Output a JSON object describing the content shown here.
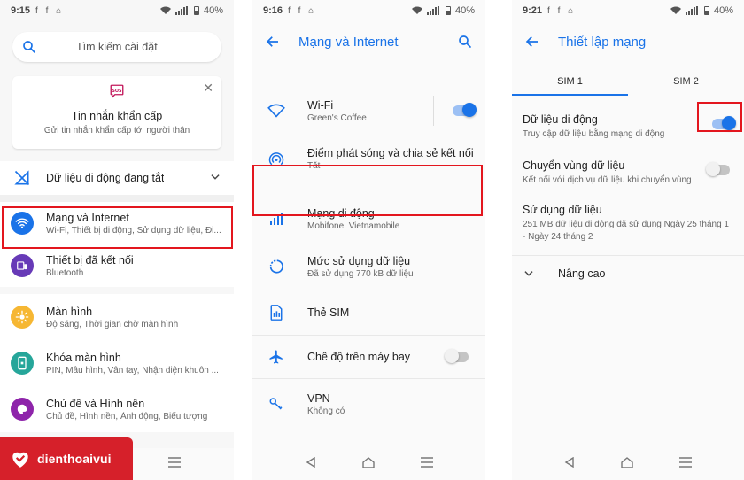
{
  "phone1": {
    "status": {
      "time": "9:15",
      "battery": "40%"
    },
    "search": {
      "placeholder": "Tìm kiếm cài đặt"
    },
    "card": {
      "title": "Tin nhắn khẩn cấp",
      "subtitle": "Gửi tin nhắn khẩn cấp tới người thân"
    },
    "items": [
      {
        "title": "Dữ liệu di động đang tắt"
      },
      {
        "title": "Mạng và Internet",
        "subtitle": "Wi-Fi, Thiết bị di động, Sử dụng dữ liệu, Đi..."
      },
      {
        "title": "Thiết bị đã kết nối",
        "subtitle": "Bluetooth"
      },
      {
        "title": "Màn hình",
        "subtitle": "Độ sáng, Thời gian chờ màn hình"
      },
      {
        "title": "Khóa màn hình",
        "subtitle": "PIN, Mẫu hình, Vân tay, Nhận diện khuôn ..."
      },
      {
        "title": "Chủ đề và Hình nền",
        "subtitle": "Chủ đề, Hình nền, Ảnh động, Biểu tượng"
      }
    ]
  },
  "phone2": {
    "status": {
      "time": "9:16",
      "battery": "40%"
    },
    "title": "Mạng và Internet",
    "items": [
      {
        "title": "Wi-Fi",
        "subtitle": "Green's Coffee"
      },
      {
        "title": "Điểm phát sóng và chia sẻ kết nối",
        "subtitle": "Tắt"
      },
      {
        "title": "Mạng di động",
        "subtitle": "Mobifone, Vietnamobile"
      },
      {
        "title": "Mức sử dụng dữ liệu",
        "subtitle": "Đã sử dụng 770 kB dữ liệu"
      },
      {
        "title": "Thẻ SIM"
      },
      {
        "title": "Chế độ trên máy bay"
      },
      {
        "title": "VPN",
        "subtitle": "Không có"
      }
    ]
  },
  "phone3": {
    "status": {
      "time": "9:21",
      "battery": "40%"
    },
    "title": "Thiết lập mạng",
    "tabs": [
      "SIM 1",
      "SIM 2"
    ],
    "items": [
      {
        "title": "Dữ liệu di động",
        "subtitle": "Truy cập dữ liệu bằng mạng di động"
      },
      {
        "title": "Chuyển vùng dữ liệu",
        "subtitle": "Kết nối với dịch vụ dữ liệu khi chuyển vùng"
      },
      {
        "title": "Sử dụng dữ liệu",
        "subtitle": "251 MB dữ liệu di động đã sử dụng Ngày 25 tháng 1 - Ngày 24 tháng 2"
      },
      {
        "title": "Nâng cao"
      }
    ]
  },
  "logo": {
    "brand": "dienthoaivui"
  },
  "colors": {
    "accent": "#1a73e8",
    "highlight": "#e3161e",
    "brand": "#d6202a"
  }
}
